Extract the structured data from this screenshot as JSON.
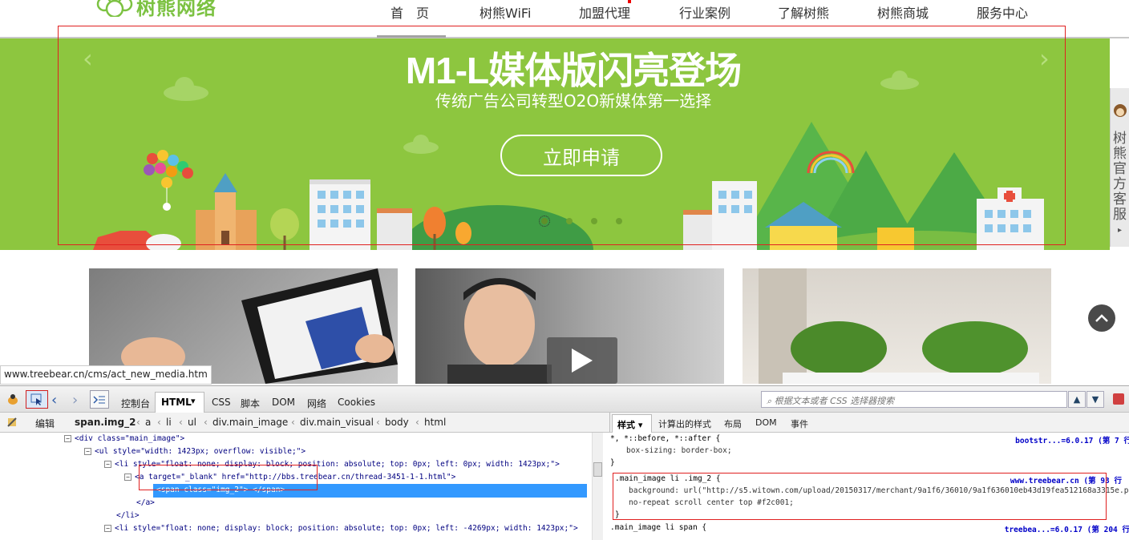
{
  "site": {
    "logo_text": "树熊网络",
    "nav": [
      "首　页",
      "树熊WiFi",
      "加盟代理",
      "行业案例",
      "了解树熊",
      "树熊商城",
      "服务中心"
    ]
  },
  "banner": {
    "title": "M1-L媒体版闪亮登场",
    "subtitle": "传统广告公司转型O2O新媒体第一选择",
    "button": "立即申请",
    "prev": "‹",
    "next": "›",
    "active_slide": 1,
    "slide_count": 4,
    "bg_color": "#8dc63f"
  },
  "side_panel": {
    "text": [
      "树",
      "熊",
      "官",
      "方",
      "客",
      "服"
    ],
    "arrow": "▸"
  },
  "status_url": "www.treebear.cn/cms/act_new_media.htm",
  "devtools": {
    "tabs": [
      "控制台",
      "HTML",
      "CSS",
      "脚本",
      "DOM",
      "网络",
      "Cookies"
    ],
    "html_dropdown": "▾",
    "search_placeholder": "根据文本或者 CSS 选择器搜索",
    "edit_label": "编辑",
    "breadcrumb": [
      "span.img_2",
      "a",
      "li",
      "ul",
      "div.main_image",
      "div.main_visual",
      "body",
      "html"
    ],
    "side_tabs": [
      "样式 ▾",
      "计算出的样式",
      "布局",
      "DOM",
      "事件"
    ],
    "html_lines": [
      {
        "indent": 1,
        "toggle": "−",
        "text": "<div class=\"main_image\">"
      },
      {
        "indent": 2,
        "toggle": "−",
        "text": "<ul style=\"width: 1423px; overflow: visible;\">"
      },
      {
        "indent": 3,
        "toggle": "−",
        "text": "<li style=\"float: none; display: block; position: absolute; top: 0px; left: 0px; width: 1423px;\">"
      },
      {
        "indent": 4,
        "toggle": "−",
        "text": "<a target=\"_blank\" href=\"http://bbs.treebear.cn/thread-3451-1-1.html\">"
      },
      {
        "indent": 5,
        "toggle": "",
        "text": "<span class=\"img_2\"> </span>",
        "selected": true
      },
      {
        "indent": 4,
        "toggle": "",
        "text": "</a>"
      },
      {
        "indent": 3,
        "toggle": "",
        "text": "</li>"
      },
      {
        "indent": 3,
        "toggle": "−",
        "text": "<li style=\"float: none; display: block; position: absolute; top: 0px; left: -4269px; width: 1423px;\">"
      }
    ],
    "css_rules": [
      {
        "selector": "*, *::before, *::after {",
        "source": "bootstr...=6.0.17 (第 7 行",
        "decls": [
          "box-sizing: border-box;"
        ]
      },
      {
        "selector": ".main_image li .img_2 {",
        "source": "www.treebear.cn (第 93 行",
        "decls": [
          "background: url(\"http://s5.witown.com/upload/20150317/merchant/9a1f6/36010/9a1f636010eb43d19fea512168a3315e.png\")",
          "  no-repeat scroll center top #f2c001;"
        ]
      },
      {
        "selector": ".main_image li span {",
        "source": "treebea...=6.0.17 (第 204 行",
        "decls": []
      }
    ]
  }
}
